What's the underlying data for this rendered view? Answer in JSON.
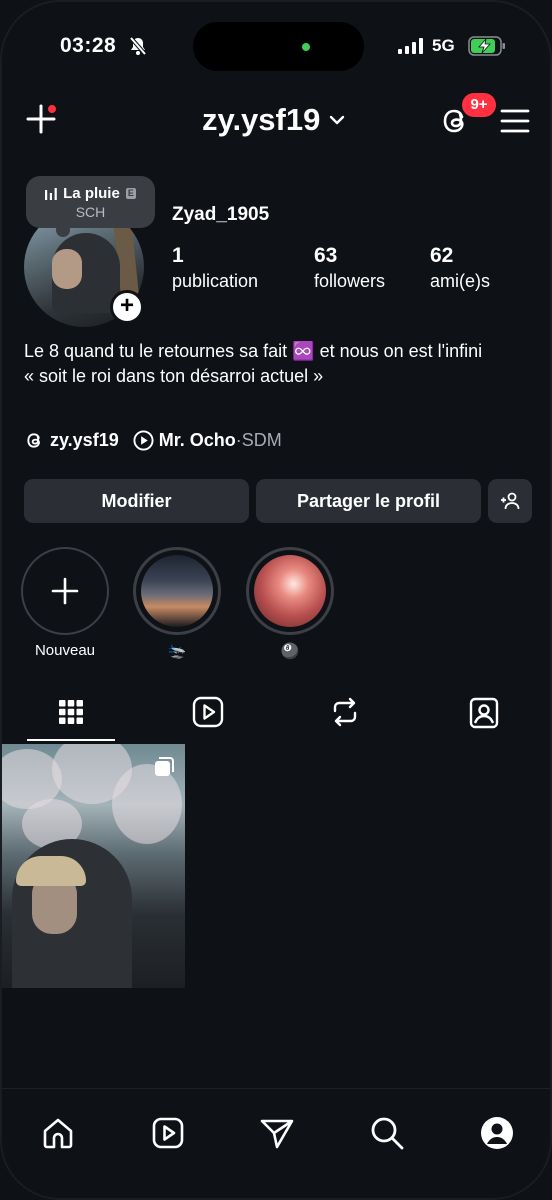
{
  "status_bar": {
    "time": "03:28",
    "network": "5G",
    "icons": [
      "bell-slash-icon",
      "signal-icon",
      "battery-charging-icon"
    ]
  },
  "header": {
    "username": "zy.ysf19",
    "threads_badge": "9+",
    "icons": [
      "plus-icon",
      "chevron-down-icon",
      "threads-icon",
      "menu-icon"
    ]
  },
  "note": {
    "song_title": "La pluie",
    "explicit_mark": "E",
    "artist": "SCH"
  },
  "profile": {
    "display_name": "Zyad_1905",
    "stats": [
      {
        "value": "1",
        "label": "publication"
      },
      {
        "value": "63",
        "label": "followers"
      },
      {
        "value": "62",
        "label": "ami(e)s"
      }
    ],
    "bio_line1": "Le 8 quand tu le retournes sa fait ♾️ et nous on est l'infini",
    "bio_line2": "« soit le roi dans ton désarroi actuel »",
    "links": {
      "threads_handle": "zy.ysf19",
      "music_name": "Mr. Ocho",
      "music_separator": " · ",
      "music_sub": "SDM"
    }
  },
  "actions": {
    "edit_label": "Modifier",
    "share_label": "Partager le profil"
  },
  "highlights": [
    {
      "label": "Nouveau"
    },
    {
      "label": "🛬"
    },
    {
      "label": "🎱"
    }
  ],
  "tabs": [
    "grid-icon",
    "reels-icon",
    "reposts-icon",
    "tagged-icon"
  ],
  "nav": [
    "home-icon",
    "reels-icon",
    "send-icon",
    "search-icon",
    "profile-icon"
  ],
  "colors": {
    "background": "#0e1116",
    "button": "#2b2f35",
    "badge": "#ff3040",
    "battery": "#3fcf56"
  }
}
